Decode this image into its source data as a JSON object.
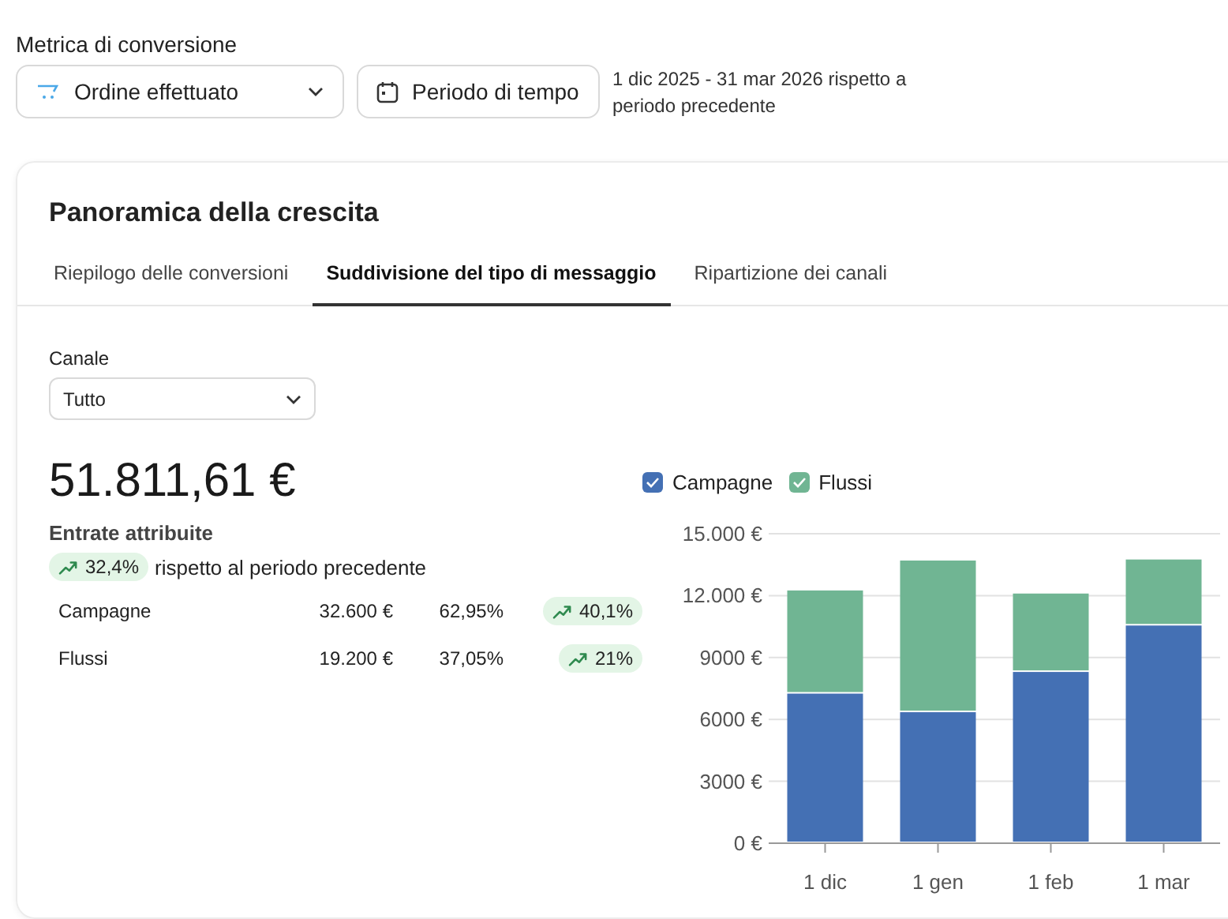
{
  "conversion_metric": {
    "label": "Metrica di conversione",
    "value": "Ordine effettuato"
  },
  "period_button": {
    "label": "Periodo di tempo"
  },
  "period_text": "1 dic 2025 - 31 mar 2026 rispetto a periodo precedente",
  "card": {
    "title": "Panoramica della crescita",
    "tabs": [
      {
        "label": "Riepilogo delle conversioni",
        "selected": false
      },
      {
        "label": "Suddivisione del tipo di messaggio",
        "selected": true
      },
      {
        "label": "Ripartizione dei canali",
        "selected": false
      }
    ],
    "channel": {
      "label": "Canale",
      "value": "Tutto"
    },
    "total": "51.811,61 €",
    "total_label": "Entrate attribuite",
    "total_change": "32,4%",
    "total_change_note": "rispetto al periodo precedente",
    "breakdown": [
      {
        "name": "Campagne",
        "amount": "32.600 €",
        "share": "62,95%",
        "change": "40,1%"
      },
      {
        "name": "Flussi",
        "amount": "19.200 €",
        "share": "37,05%",
        "change": "21%"
      }
    ],
    "chart_data": {
      "type": "bar",
      "stacked": true,
      "grid": true,
      "legend": "top",
      "categories": [
        "1 dic",
        "1 gen",
        "1 feb",
        "1 mar"
      ],
      "series": [
        {
          "name": "Campagne",
          "color": "#4470b4",
          "values": [
            7250,
            6350,
            8300,
            10550
          ]
        },
        {
          "name": "Flussi",
          "color": "#70b593",
          "values": [
            5000,
            7350,
            3800,
            3200
          ]
        }
      ],
      "ylim": [
        0,
        15000
      ],
      "yticks": [
        {
          "value": 0,
          "label": "0 €"
        },
        {
          "value": 3000,
          "label": "3000 €"
        },
        {
          "value": 6000,
          "label": "6000 €"
        },
        {
          "value": 9000,
          "label": "9000 €"
        },
        {
          "value": 12000,
          "label": "12.000 €"
        },
        {
          "value": 15000,
          "label": "15.000 €"
        }
      ]
    }
  }
}
